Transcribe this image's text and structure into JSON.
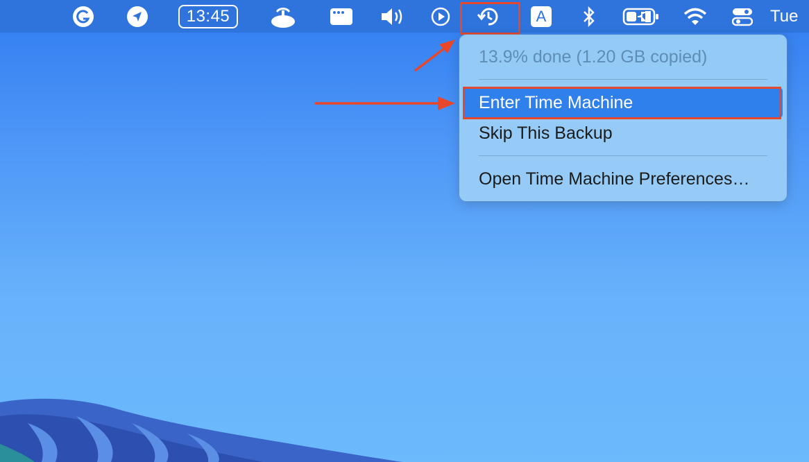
{
  "menubar": {
    "clock": "13:45",
    "day": "Tue",
    "input_source": "A",
    "icons": [
      "grammarly-icon",
      "location-icon",
      "clock-badge",
      "fan-icon",
      "window-icon",
      "volume-icon",
      "play-icon",
      "time-machine-icon",
      "input-source-icon",
      "bluetooth-icon",
      "battery-icon",
      "wifi-icon",
      "control-center-icon"
    ]
  },
  "time_machine_menu": {
    "status": "13.9% done (1.20 GB copied)",
    "items": [
      {
        "label": "Enter Time Machine",
        "selected": true
      },
      {
        "label": "Skip This Backup",
        "selected": false
      },
      {
        "label": "Open Time Machine Preferences…",
        "selected": false
      }
    ]
  },
  "colors": {
    "menubar": "#2f74dc",
    "annotation": "#e8472a",
    "selection": "#2f80ea"
  }
}
